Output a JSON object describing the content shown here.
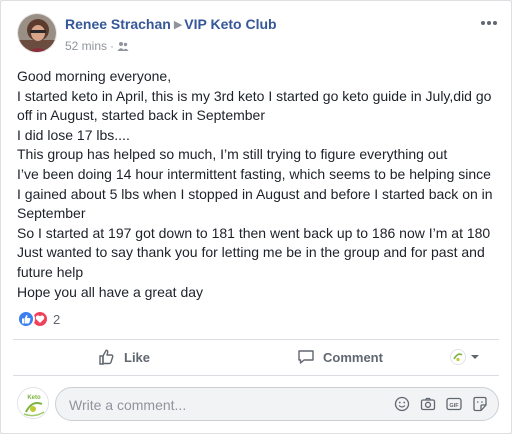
{
  "post": {
    "author": "Renee Strachan",
    "group": "VIP Keto Club",
    "timestamp": "52 mins",
    "privacy_icon": "group-icon",
    "more_icon": "more-options-icon",
    "body_lines": [
      "Good morning everyone,",
      "I started keto in April, this is my 3rd keto I started go keto guide in July,did go",
      "off in August, started back in September",
      "I did lose 17 lbs....",
      "This group has helped so much, I’m still trying to figure everything out",
      "I’ve been doing 14 hour intermittent fasting, which seems to be helping since",
      "I gained about 5 lbs when I stopped in August and before I started back on in",
      "September",
      "So I started at 197 got down to 181 then went back up to 186 now I’m at 180",
      "Just wanted to say thank you for letting me be in the group and for past and",
      "future help",
      "Hope you all have a great day"
    ]
  },
  "reactions": {
    "icons": [
      "like-reaction-icon",
      "love-reaction-icon"
    ],
    "count": "2"
  },
  "actions": {
    "like_label": "Like",
    "comment_label": "Comment"
  },
  "composer": {
    "placeholder": "Write a comment...",
    "icons": [
      "emoji-icon",
      "camera-icon",
      "gif-icon",
      "sticker-icon"
    ]
  },
  "colors": {
    "link": "#365899",
    "text": "#1d2129",
    "muted": "#606770",
    "like_blue": "#3b80ef",
    "love_red": "#f0405a"
  }
}
